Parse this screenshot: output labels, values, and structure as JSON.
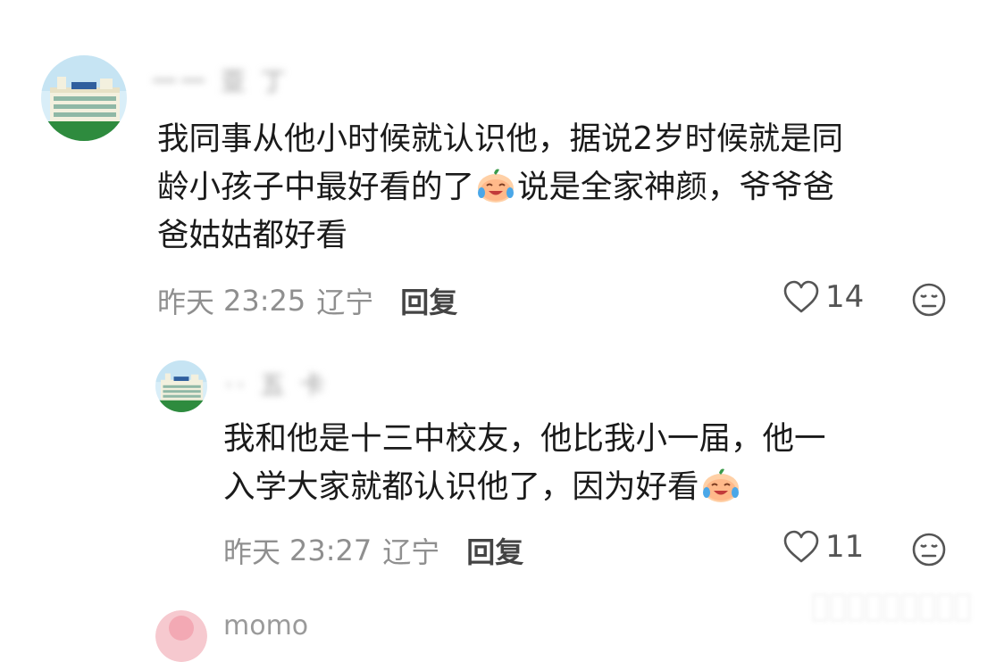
{
  "comments": [
    {
      "username": "一一 亚 丁",
      "lines": [
        [
          {
            "t": "我同事从他小时候就认识他，据说2岁时候就是同"
          }
        ],
        [
          {
            "t": "龄小孩子中最好看的了"
          },
          {
            "emoji": "crying-laughing"
          },
          {
            "t": "说是全家神颜，爷爷爸"
          }
        ],
        [
          {
            "t": "爸姑姑都好看"
          }
        ]
      ],
      "date": "昨天",
      "time": "23:25",
      "location": "辽宁",
      "reply_label": "回复",
      "likes": "14"
    },
    {
      "username": "·· 五 卡",
      "lines": [
        [
          {
            "t": "我和他是十三中校友，他比我小一届，他一"
          }
        ],
        [
          {
            "t": "入学大家就都认识他了，因为好看"
          },
          {
            "emoji": "crying-laughing"
          }
        ]
      ],
      "date": "昨天",
      "time": "23:27",
      "location": "辽宁",
      "reply_label": "回复",
      "likes": "11"
    }
  ],
  "next_comment": {
    "username": "momo"
  },
  "icons": {
    "like": "heart-outline-icon",
    "dislike": "meh-face-icon",
    "emoji": "crying-laughing-emoji-icon"
  },
  "colors": {
    "text_primary": "#1a1a1a",
    "text_meta": "#8f8f8f",
    "reply": "#444444"
  }
}
